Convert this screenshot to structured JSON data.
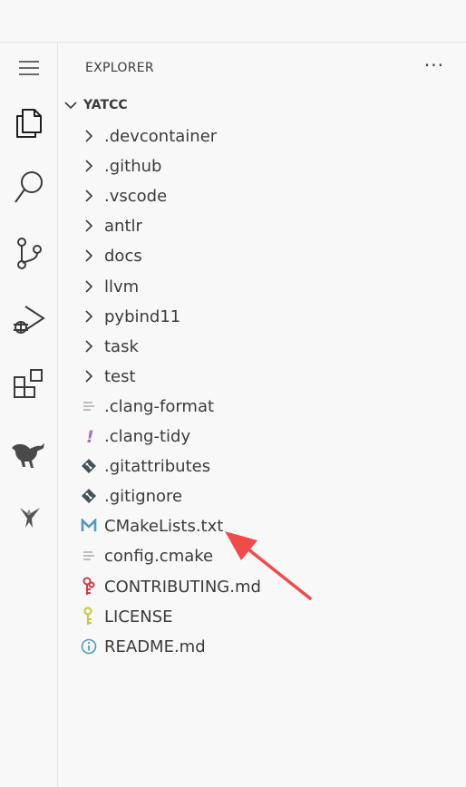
{
  "sidebar": {
    "title": "EXPLORER",
    "more": "···",
    "root": "YATCC",
    "items": [
      {
        "label": ".devcontainer",
        "kind": "folder",
        "icon": "chevron-right-icon"
      },
      {
        "label": ".github",
        "kind": "folder",
        "icon": "chevron-right-icon"
      },
      {
        "label": ".vscode",
        "kind": "folder",
        "icon": "chevron-right-icon"
      },
      {
        "label": "antlr",
        "kind": "folder",
        "icon": "chevron-right-icon"
      },
      {
        "label": "docs",
        "kind": "folder",
        "icon": "chevron-right-icon"
      },
      {
        "label": "llvm",
        "kind": "folder",
        "icon": "chevron-right-icon"
      },
      {
        "label": "pybind11",
        "kind": "folder",
        "icon": "chevron-right-icon"
      },
      {
        "label": "task",
        "kind": "folder",
        "icon": "chevron-right-icon"
      },
      {
        "label": "test",
        "kind": "folder",
        "icon": "chevron-right-icon"
      },
      {
        "label": ".clang-format",
        "kind": "file",
        "icon": "text-lines-icon"
      },
      {
        "label": ".clang-tidy",
        "kind": "file",
        "icon": "exclamation-icon"
      },
      {
        "label": ".gitattributes",
        "kind": "file",
        "icon": "git-diamond-icon"
      },
      {
        "label": ".gitignore",
        "kind": "file",
        "icon": "git-diamond-icon"
      },
      {
        "label": "CMakeLists.txt",
        "kind": "file",
        "icon": "cmake-m-icon"
      },
      {
        "label": "config.cmake",
        "kind": "file",
        "icon": "text-lines-icon"
      },
      {
        "label": "CONTRIBUTING.md",
        "kind": "file",
        "icon": "red-key-icon"
      },
      {
        "label": "LICENSE",
        "kind": "file",
        "icon": "yellow-key-icon"
      },
      {
        "label": "README.md",
        "kind": "file",
        "icon": "info-circle-icon"
      }
    ]
  },
  "activity_bar": [
    {
      "icon": "menu-icon"
    },
    {
      "icon": "explorer-files-icon"
    },
    {
      "icon": "search-icon"
    },
    {
      "icon": "source-control-icon"
    },
    {
      "icon": "run-debug-icon"
    },
    {
      "icon": "extensions-icon"
    },
    {
      "icon": "kangaroo-icon"
    },
    {
      "icon": "bird-icon"
    }
  ],
  "colors": {
    "background": "#f8f8f8",
    "text": "#3b3b3b",
    "annotation_arrow": "#f04a4a",
    "exclamation": "#a074c4",
    "cmake": "#519aba",
    "git": "#41535b",
    "red_key": "#cc3e44",
    "yellow_key": "#cbcb41",
    "info": "#519aba"
  }
}
